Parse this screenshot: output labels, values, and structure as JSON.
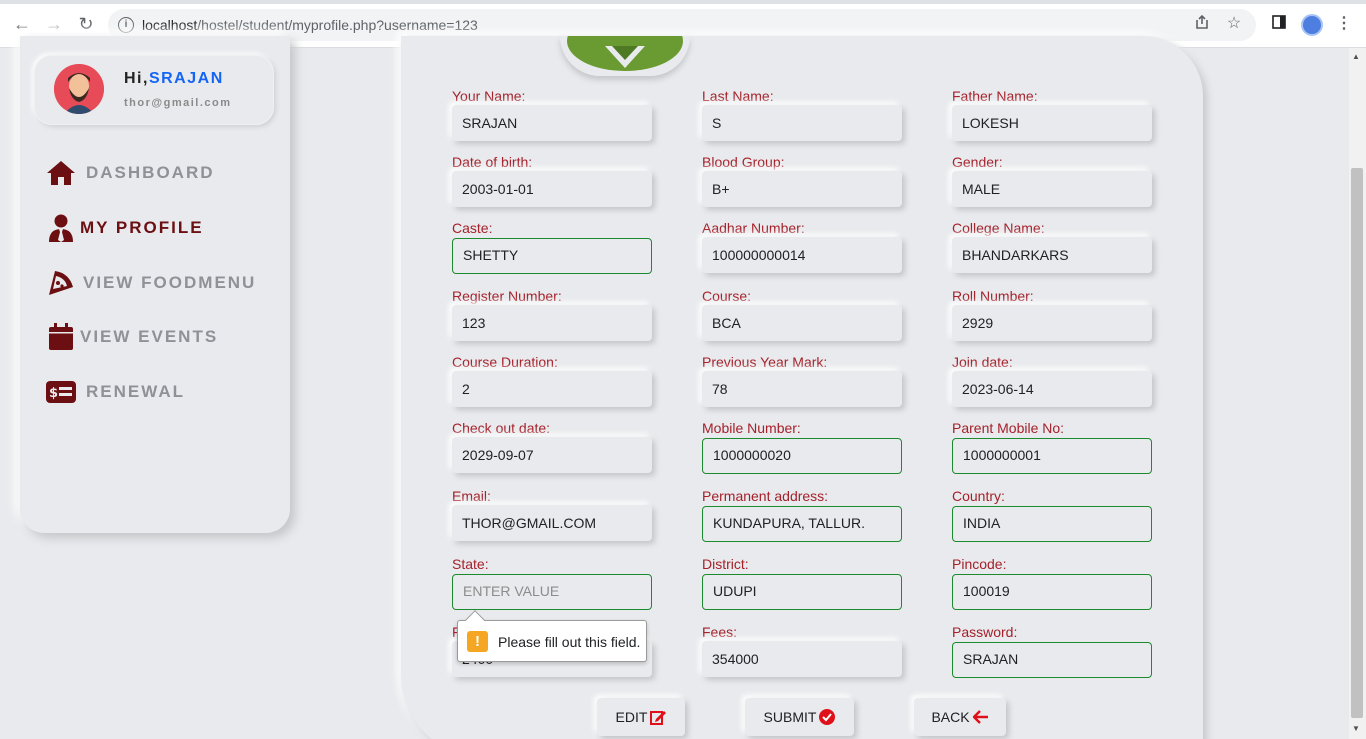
{
  "browser": {
    "url_host": "localhost",
    "url_path": "/hostel/student/myprofile.php?username=123"
  },
  "sidebar": {
    "greeting_prefix": "Hi,",
    "user_name": "SRAJAN",
    "user_email": "thor@gmail.com",
    "items": [
      {
        "label": "DASHBOARD",
        "icon": "home-icon"
      },
      {
        "label": "MY PROFILE",
        "icon": "user-tie-icon"
      },
      {
        "label": "VIEW FOODMENU",
        "icon": "pizza-icon"
      },
      {
        "label": "VIEW EVENTS",
        "icon": "calendar-icon"
      },
      {
        "label": "RENEWAL",
        "icon": "money-bill-icon"
      }
    ]
  },
  "form": {
    "fields": [
      {
        "label_a": "Your Name:",
        "label_b": "",
        "value": "SRAJAN"
      },
      {
        "label_a": "Last Name:",
        "label_b": "",
        "value": "S"
      },
      {
        "label_a": "Father Name:",
        "label_b": "",
        "value": "LOKESH"
      },
      {
        "label_a": "Date of birth:",
        "label_b": "",
        "value": "2003-01-01"
      },
      {
        "label_a": "Blood Group:",
        "label_b": "",
        "value": "B+"
      },
      {
        "label_a": "Gender:",
        "label_b": "",
        "value": "MALE"
      },
      {
        "label_a": "Caste:",
        "label_b": "",
        "value": "SHETTY"
      },
      {
        "label_a": "Aadhar Number:",
        "label_b": "",
        "value": "100000000014"
      },
      {
        "label_a": "College Name:",
        "label_b": "",
        "value": "BHANDARKARS"
      },
      {
        "label_a": "Register Number:",
        "label_b": "",
        "value": "123"
      },
      {
        "label_a": "Course:",
        "label_b": "",
        "value": "BCA"
      },
      {
        "label_a": "Roll Number:",
        "label_b": "",
        "value": "2929"
      },
      {
        "label_a": "Course Duration:",
        "label_b": "",
        "value": "2"
      },
      {
        "label_a": "Previous Year Mark:",
        "label_b": "",
        "value": "78"
      },
      {
        "label_a": "Join date:",
        "label_b": "",
        "value": "2023-06-14"
      },
      {
        "label_a": "Check out date:",
        "label_b": "",
        "value": "2029-09-07"
      },
      {
        "label_a": "Mobile Number:",
        "label_b": "",
        "value": "1000000020"
      },
      {
        "label_a": "Parent Mobile No:",
        "label_b": "",
        "value": "1000000001"
      },
      {
        "label_a": "Email:",
        "label_b": "",
        "value": "THOR@GMAIL.COM"
      },
      {
        "label_a": "Permanent address:",
        "label_b": "",
        "value": "KUNDAPURA, TALLUR."
      },
      {
        "label_a": "Country:",
        "label_b": "",
        "value": "INDIA"
      },
      {
        "label_a": "State:",
        "label_b": "",
        "value": "",
        "placeholder": "ENTER VALUE"
      },
      {
        "label_a": "District:",
        "label_b": "",
        "value": "UDUPI"
      },
      {
        "label_a": "Pincode:",
        "label_b": "",
        "value": "100019"
      },
      {
        "label_a": "F",
        "label_b": "",
        "value": "2400"
      },
      {
        "label_a": "Fees:",
        "label_b": "",
        "value": "354000"
      },
      {
        "label_a": "Password:",
        "label_b": "",
        "value": "SRAJAN"
      }
    ],
    "validation_message": "Please fill out this field."
  },
  "buttons": {
    "edit": "EDIT",
    "submit": "SUBMIT",
    "back": "BACK"
  },
  "colors": {
    "accent_label": "#a5212a",
    "active_menu": "#6b0f12",
    "valid_border": "#1e8a2f",
    "greeting_name": "#1565f5"
  }
}
